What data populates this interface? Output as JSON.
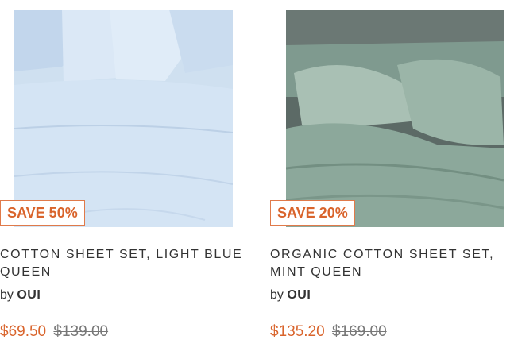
{
  "products": [
    {
      "badge": "SAVE 50%",
      "title": "COTTON SHEET SET, LIGHT BLUE QUEEN",
      "by_prefix": "by",
      "brand": "OUI",
      "sale_price": "$69.50",
      "original_price": "$139.00"
    },
    {
      "badge": "SAVE 20%",
      "title": "ORGANIC COTTON SHEET SET, MINT QUEEN",
      "by_prefix": "by",
      "brand": "OUI",
      "sale_price": "$135.20",
      "original_price": "$169.00"
    }
  ],
  "colors": {
    "accent": "#d9642c",
    "badge_border": "#e07a4a",
    "text": "#333333",
    "strike": "#777777"
  }
}
